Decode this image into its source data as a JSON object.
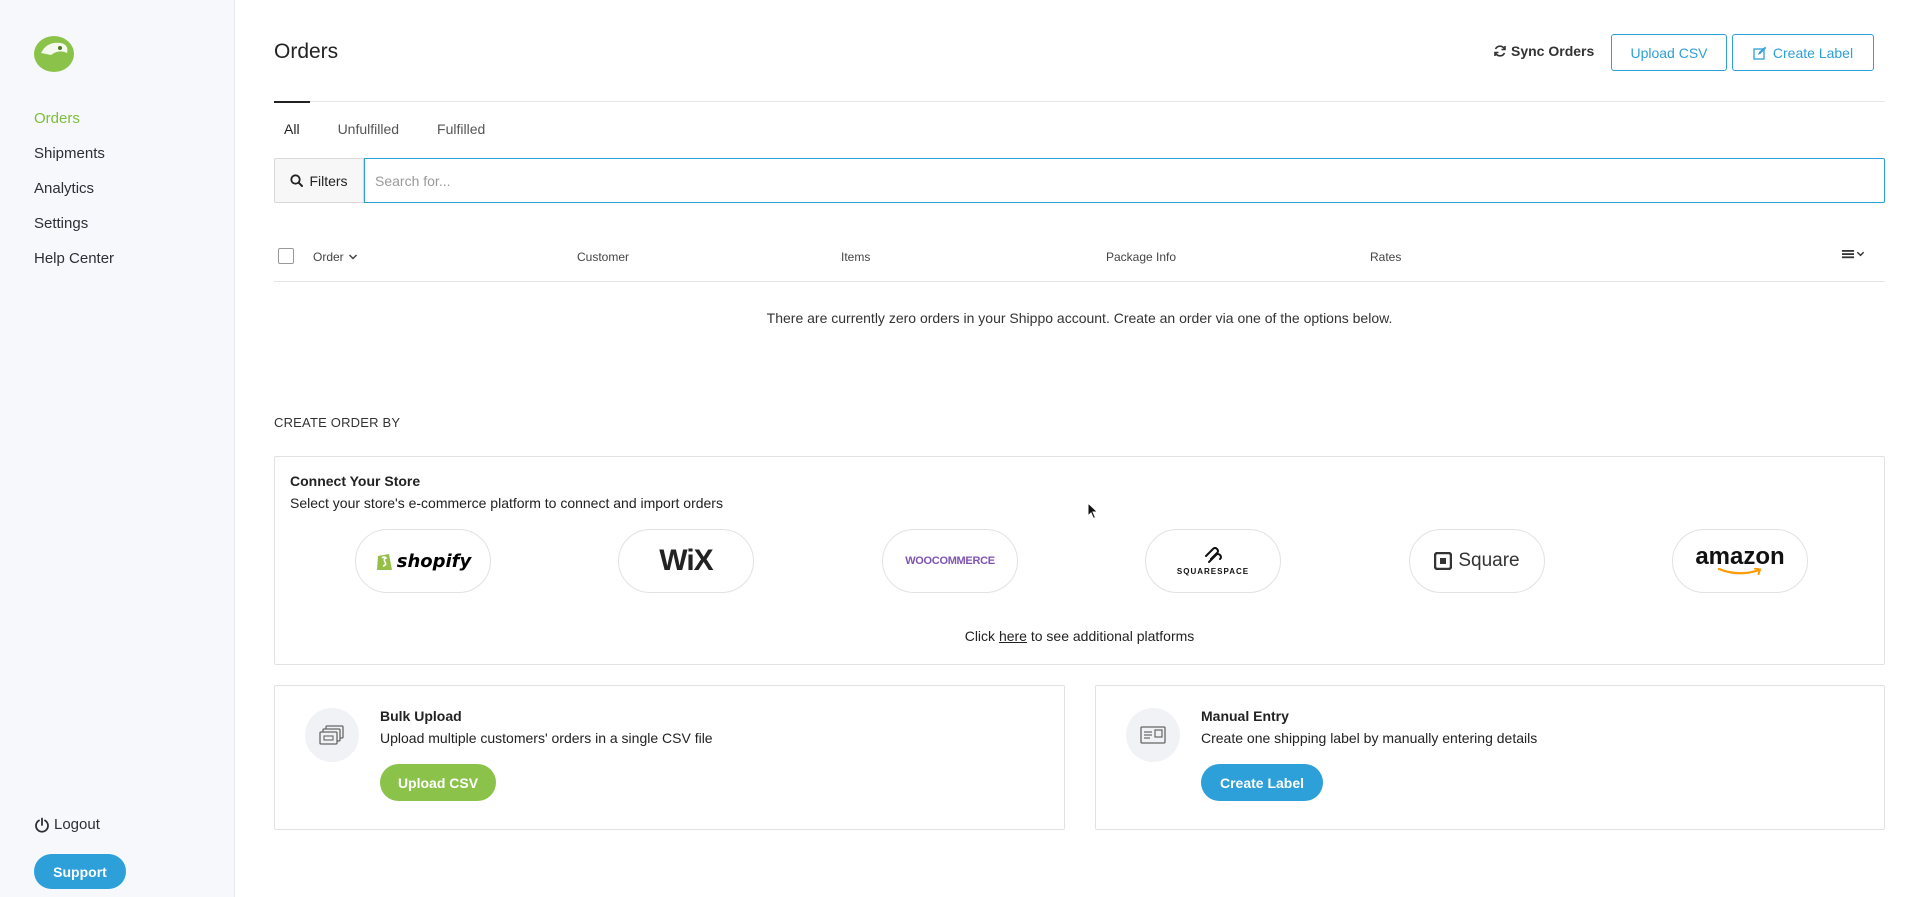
{
  "sidebar": {
    "nav": [
      "Orders",
      "Shipments",
      "Analytics",
      "Settings",
      "Help Center"
    ],
    "active": "Orders",
    "logout_label": "Logout",
    "support_label": "Support"
  },
  "header": {
    "title": "Orders",
    "sync_label": "Sync Orders",
    "upload_csv_label": "Upload CSV",
    "create_label_label": "Create Label"
  },
  "tabs": [
    "All",
    "Unfulfilled",
    "Fulfilled"
  ],
  "active_tab": "All",
  "search": {
    "filters_label": "Filters",
    "placeholder": "Search for..."
  },
  "table": {
    "columns": [
      "Order",
      "Customer",
      "Items",
      "Package Info",
      "Rates"
    ],
    "empty_message": "There are currently zero orders in your Shippo account. Create an order via one of the options below."
  },
  "create_section": {
    "label": "CREATE ORDER BY",
    "store": {
      "title": "Connect Your Store",
      "subtitle": "Select your store's e-commerce platform to connect and import orders",
      "platforms": [
        "shopify",
        "WiX",
        "WOOCOMMERCE",
        "SQUARESPACE",
        "Square",
        "amazon"
      ],
      "footer_prefix": "Click ",
      "footer_link": "here",
      "footer_suffix": " to see additional platforms"
    },
    "bulk": {
      "title": "Bulk Upload",
      "subtitle": "Upload multiple customers' orders in a single CSV file",
      "button": "Upload CSV"
    },
    "manual": {
      "title": "Manual Entry",
      "subtitle": "Create one shipping label by manually entering details",
      "button": "Create Label"
    }
  },
  "colors": {
    "brand_green": "#7cbf3a",
    "accent_blue": "#2d9fd9",
    "button_green": "#8bc34a"
  }
}
